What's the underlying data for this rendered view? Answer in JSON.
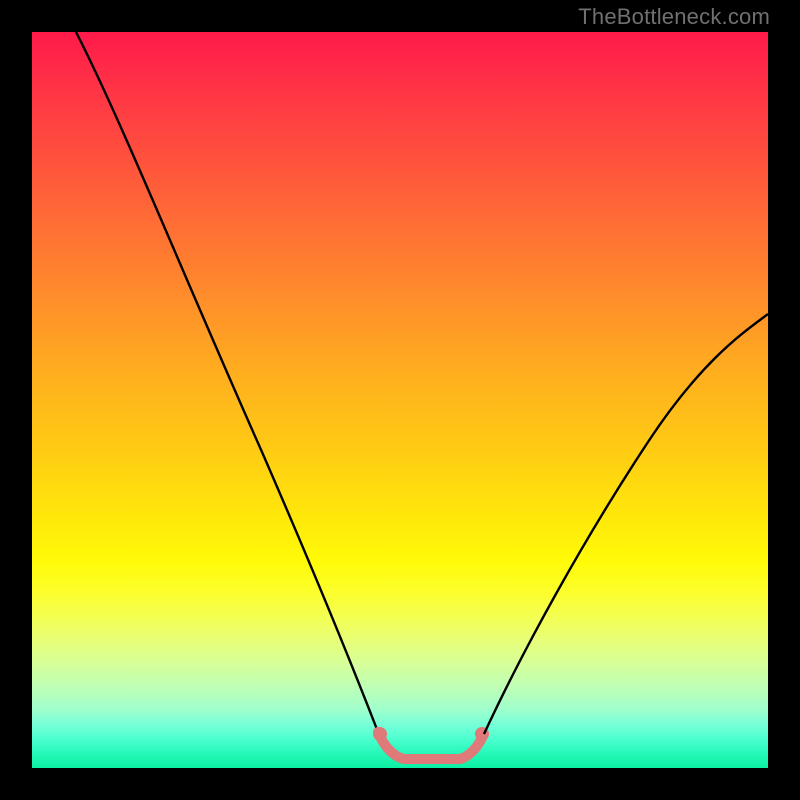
{
  "watermark": "TheBottleneck.com",
  "colors": {
    "curve_stroke": "#000000",
    "bottom_curve_stroke": "#e07a7a",
    "gradient_top": "#ff1a4a",
    "gradient_bottom": "#0cf0a3",
    "frame": "#000000"
  },
  "chart_data": {
    "type": "line",
    "title": "",
    "xlabel": "",
    "ylabel": "",
    "xlim": [
      0,
      100
    ],
    "ylim": [
      0,
      100
    ],
    "grid": false,
    "legend": false,
    "series": [
      {
        "name": "bottleneck-curve-left",
        "x": [
          6,
          10,
          15,
          20,
          25,
          30,
          35,
          40,
          44,
          47
        ],
        "y": [
          100,
          92,
          81,
          69,
          57,
          44,
          32,
          18,
          8,
          3
        ]
      },
      {
        "name": "bottleneck-curve-bottom",
        "x": [
          47,
          49,
          52,
          55,
          58,
          60
        ],
        "y": [
          3,
          1.2,
          0.7,
          0.7,
          1.2,
          3
        ]
      },
      {
        "name": "bottleneck-curve-right",
        "x": [
          60,
          64,
          70,
          76,
          82,
          88,
          94,
          100
        ],
        "y": [
          3,
          8,
          18,
          28,
          38,
          47,
          55,
          62
        ]
      }
    ],
    "annotations": [
      {
        "text": "TheBottleneck.com",
        "position": "top-right"
      }
    ]
  }
}
